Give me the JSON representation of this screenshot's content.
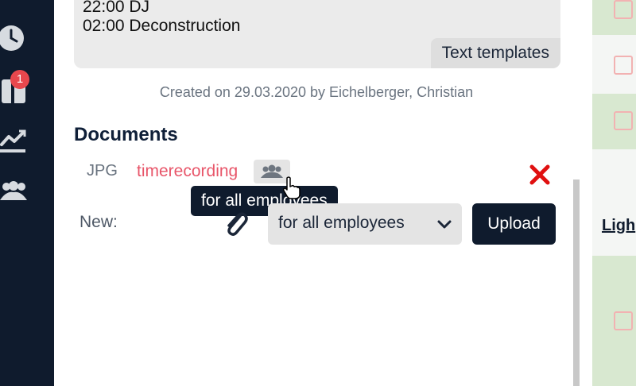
{
  "sidebar": {
    "icons": [
      "clock-icon",
      "calendar-icon",
      "chart-trend-icon",
      "users-icon"
    ],
    "notification_badge": "1"
  },
  "notes": {
    "lines": [
      "22:00 DJ",
      "02:00 Deconstruction"
    ],
    "templates_button": "Text templates"
  },
  "created_text": "Created on 29.03.2020 by Eichelberger, Christian",
  "documents": {
    "title": "Documents",
    "items": [
      {
        "type": "JPG",
        "name": "timerecording",
        "visibility_icon": "users-icon",
        "tooltip": "for all employees"
      }
    ],
    "new": {
      "label": "New:",
      "visibility_select": "for all employees",
      "upload_button": "Upload"
    }
  },
  "right_panel": {
    "link_text": "Ligh"
  },
  "colors": {
    "sidebar_bg": "#0f1b2d",
    "accent_dark": "#0f1b2d",
    "document_link": "#e8566a",
    "delete": "#e01010",
    "badge": "#e8474d"
  }
}
